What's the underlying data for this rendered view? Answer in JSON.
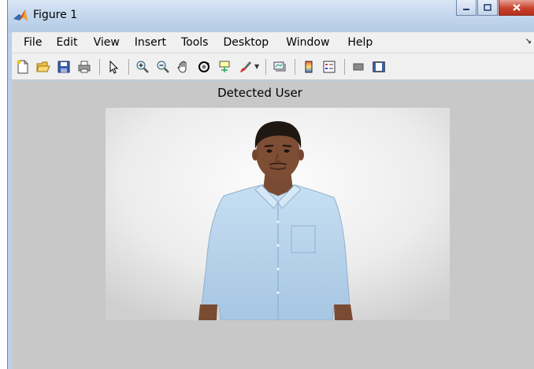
{
  "window": {
    "title": "Figure 1"
  },
  "menu": {
    "items": [
      "File",
      "Edit",
      "View",
      "Insert",
      "Tools",
      "Desktop",
      "Window",
      "Help"
    ]
  },
  "toolbar": {
    "icons": [
      "new-figure-icon",
      "open-file-icon",
      "save-icon",
      "print-icon",
      "pointer-icon",
      "zoom-in-icon",
      "zoom-out-icon",
      "pan-hand-icon",
      "rotate-3d-icon",
      "data-cursor-icon",
      "brush-icon",
      "link-plot-icon",
      "colorbar-icon",
      "legend-icon",
      "hide-plot-tools-icon",
      "show-plot-tools-icon"
    ]
  },
  "figure": {
    "plot_title": "Detected User"
  },
  "colors": {
    "figure_bg": "#c8c8c8",
    "titlebar": "#c5d8ee",
    "close_button": "#c8412c"
  }
}
